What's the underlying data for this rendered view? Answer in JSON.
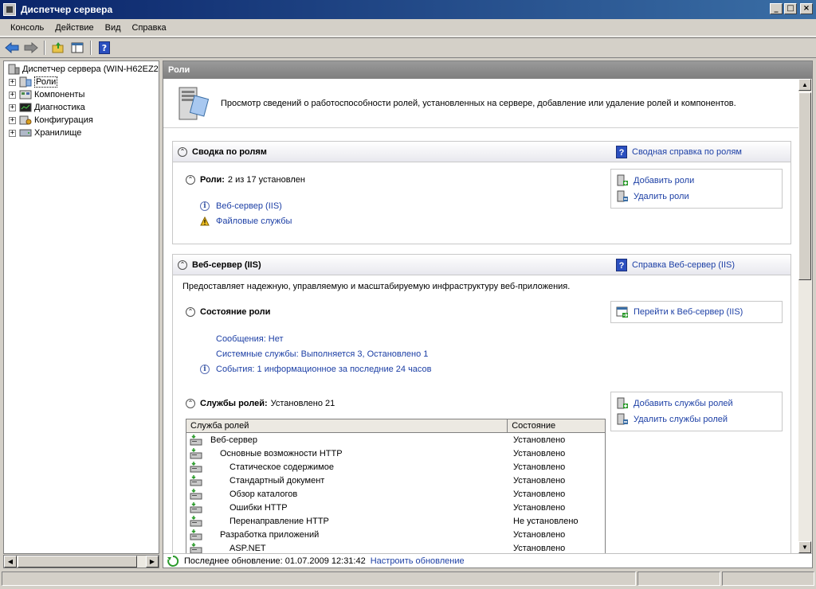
{
  "window": {
    "title": "Диспетчер сервера"
  },
  "menu": [
    "Консоль",
    "Действие",
    "Вид",
    "Справка"
  ],
  "tree": {
    "root": "Диспетчер сервера (WIN-H62EZ2",
    "items": [
      {
        "label": "Роли",
        "selected": true
      },
      {
        "label": "Компоненты"
      },
      {
        "label": "Диагностика"
      },
      {
        "label": "Конфигурация"
      },
      {
        "label": "Хранилище"
      }
    ]
  },
  "pane": {
    "title": "Роли",
    "intro": "Просмотр сведений о работоспособности ролей, установленных на сервере, добавление или удаление ролей и компонентов."
  },
  "roles_summary": {
    "title": "Сводка по ролям",
    "help": "Сводная справка по ролям",
    "roles_label": "Роли:",
    "roles_count": "2 из 17 установлен",
    "roles": [
      "Веб-сервер (IIS)",
      "Файловые службы"
    ],
    "actions": [
      "Добавить роли",
      "Удалить роли"
    ]
  },
  "web_server": {
    "title": "Веб-сервер (IIS)",
    "help": "Справка Веб-сервер (IIS)",
    "description": "Предоставляет надежную, управляемую и масштабируемую инфраструктуру веб-приложения.",
    "status_title": "Состояние роли",
    "goto": "Перейти к Веб-сервер (IIS)",
    "status_lines": [
      "Сообщения: Нет",
      "Системные службы: Выполняется 3, Остановлено 1",
      "События: 1 информационное за последние 24 часов"
    ],
    "services_title": "Службы ролей:",
    "services_count": "Установлено 21",
    "services_actions": [
      "Добавить службы ролей",
      "Удалить службы ролей"
    ],
    "table": {
      "headers": [
        "Служба ролей",
        "Состояние"
      ],
      "rows": [
        {
          "name": "Веб-сервер",
          "level": 0,
          "state": "Установлено"
        },
        {
          "name": "Основные возможности HTTP",
          "level": 1,
          "state": "Установлено"
        },
        {
          "name": "Статическое содержимое",
          "level": 2,
          "state": "Установлено"
        },
        {
          "name": "Стандартный документ",
          "level": 2,
          "state": "Установлено"
        },
        {
          "name": "Обзор каталогов",
          "level": 2,
          "state": "Установлено"
        },
        {
          "name": "Ошибки HTTP",
          "level": 2,
          "state": "Установлено"
        },
        {
          "name": "Перенаправление HTTP",
          "level": 2,
          "state": "Не установлено"
        },
        {
          "name": "Разработка приложений",
          "level": 1,
          "state": "Установлено"
        },
        {
          "name": "ASP.NET",
          "level": 2,
          "state": "Установлено"
        }
      ]
    }
  },
  "footer": {
    "last_update": "Последнее обновление: 01.07.2009 12:31:42",
    "configure": "Настроить обновление"
  }
}
